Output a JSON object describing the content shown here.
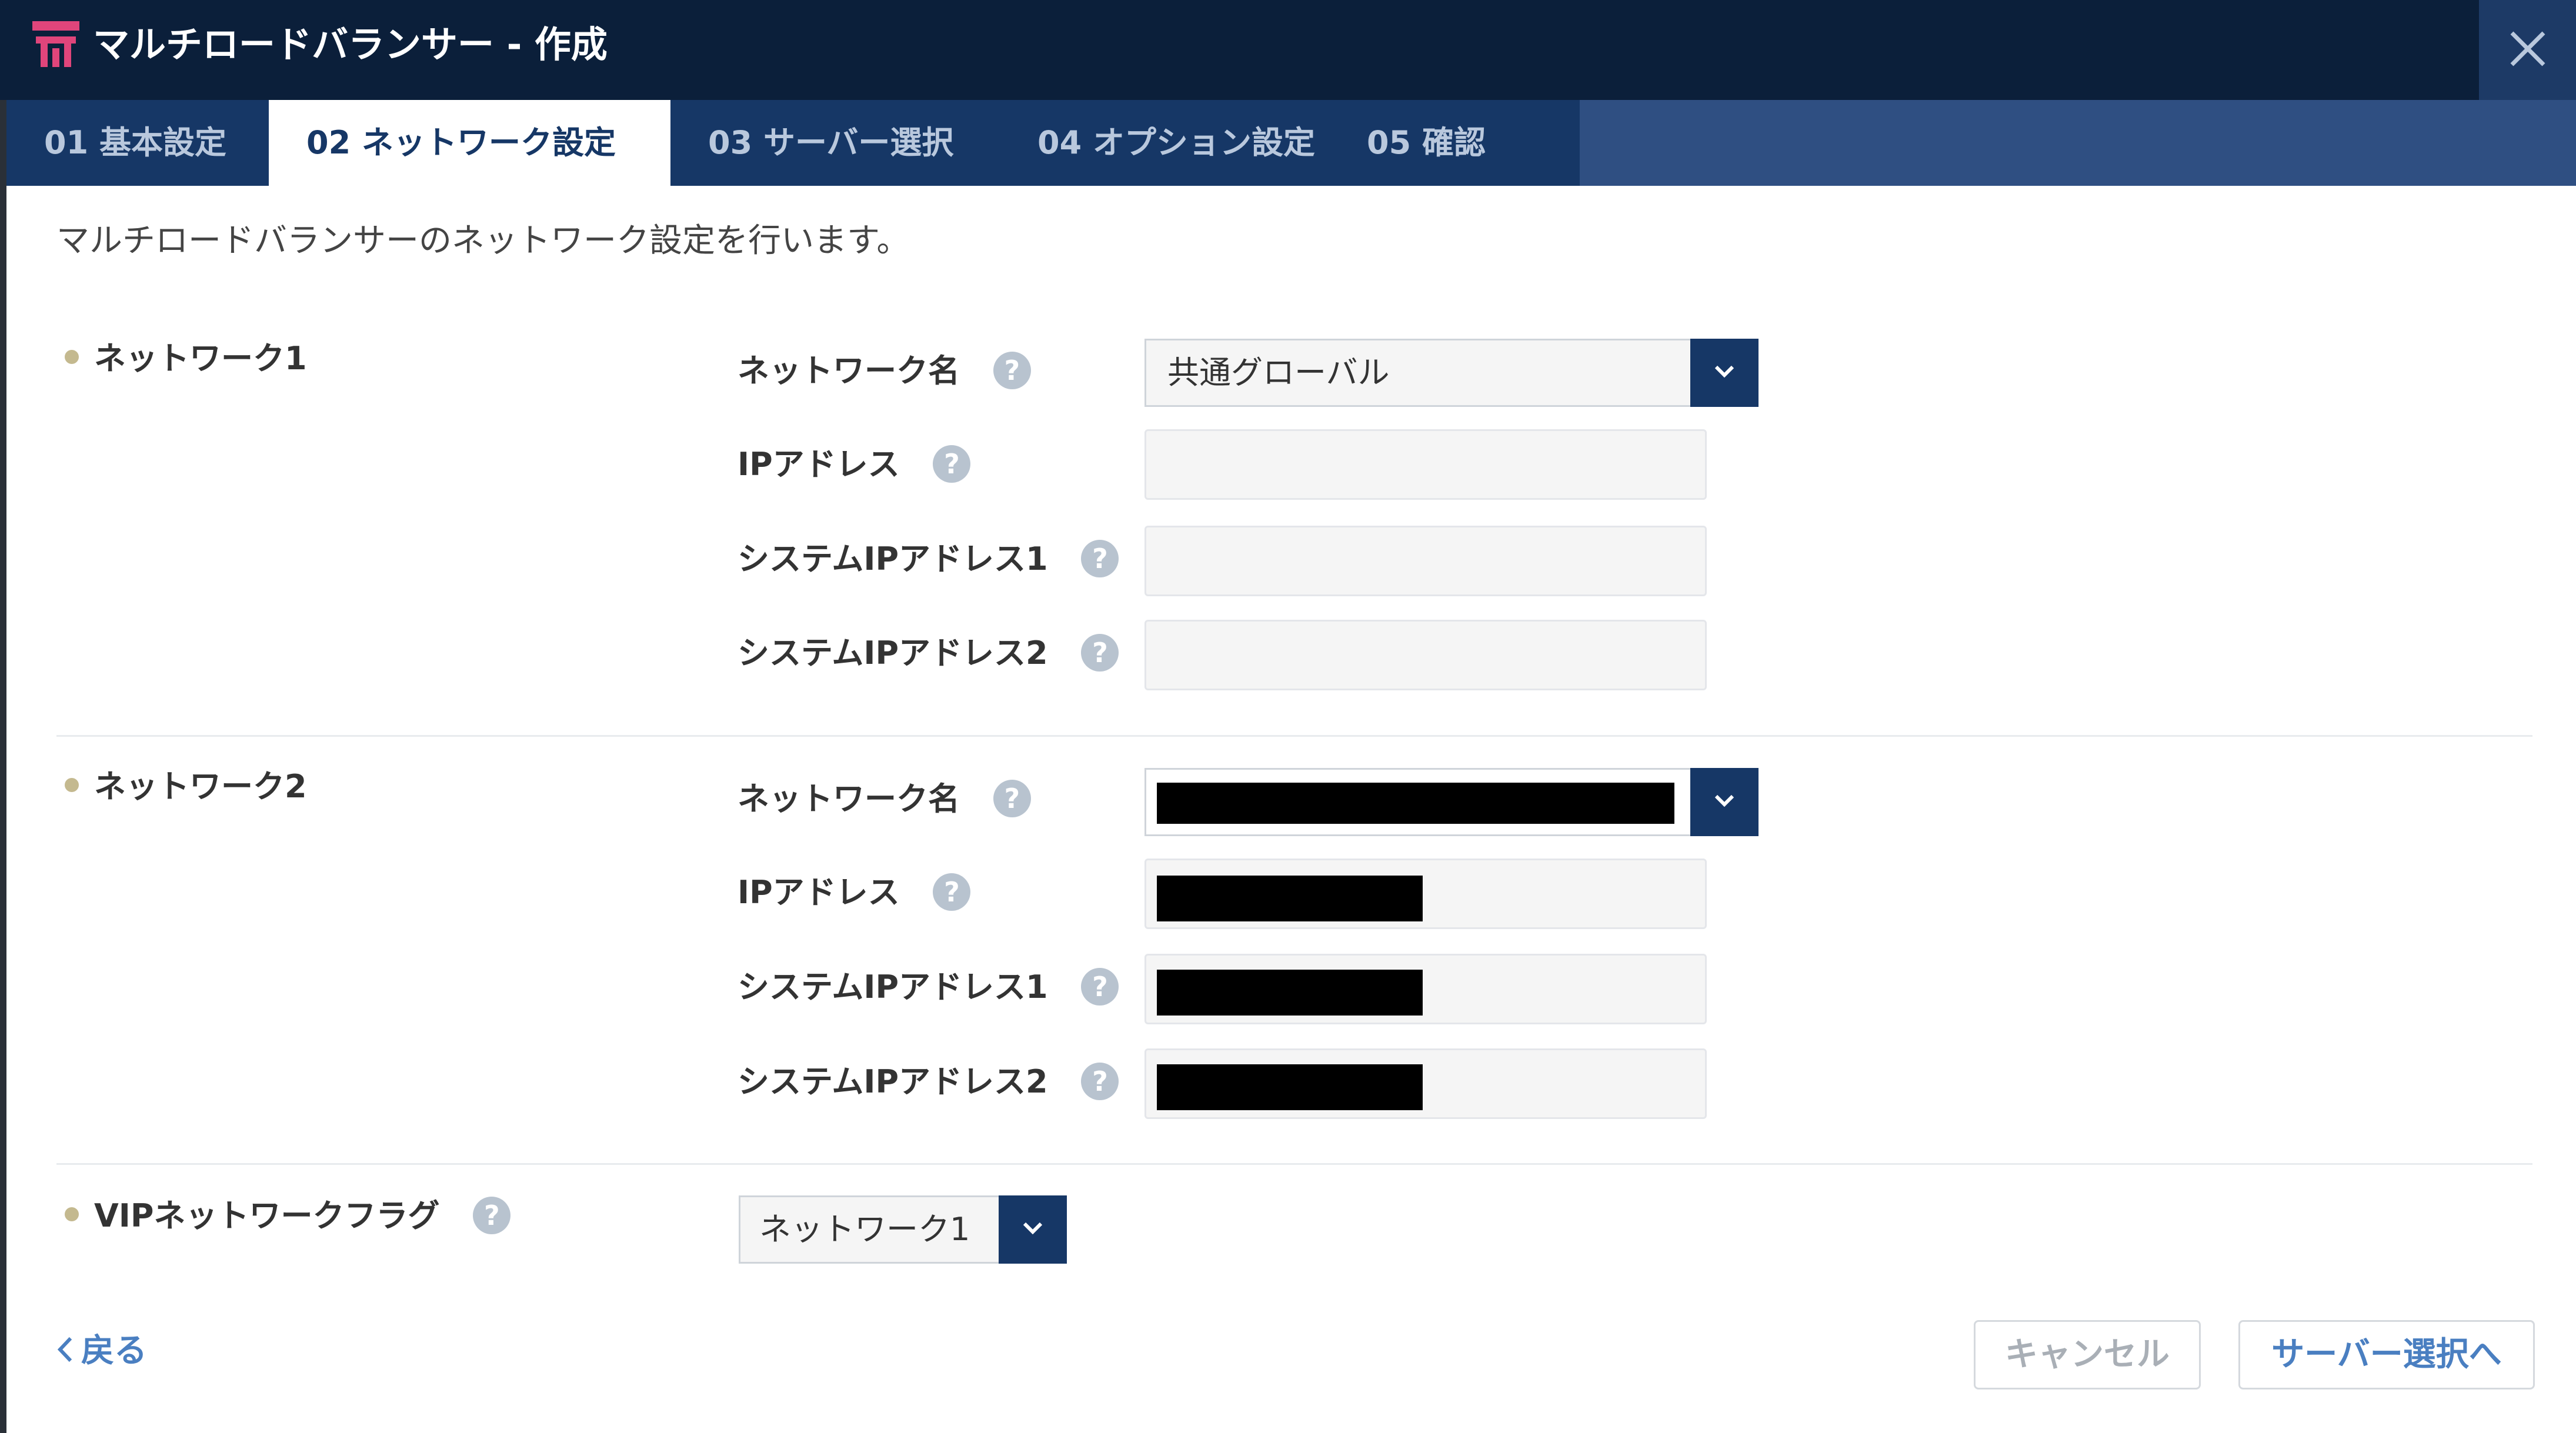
{
  "window": {
    "title": "マルチロードバランサー - 作成"
  },
  "tabs": [
    {
      "label": "01 基本設定",
      "active": false
    },
    {
      "label": "02 ネットワーク設定",
      "active": true
    },
    {
      "label": "03 サーバー選択",
      "active": false
    },
    {
      "label": "04 オプション設定",
      "active": false
    },
    {
      "label": "05 確認",
      "active": false
    }
  ],
  "intro": "マルチロードバランサーのネットワーク設定を行います。",
  "network1": {
    "title": "ネットワーク1",
    "network_name_label": "ネットワーク名",
    "network_name_value": "共通グローバル",
    "ip_label": "IPアドレス",
    "ip_value": "",
    "sys_ip1_label": "システムIPアドレス1",
    "sys_ip1_value": "",
    "sys_ip2_label": "システムIPアドレス2",
    "sys_ip2_value": ""
  },
  "network2": {
    "title": "ネットワーク2",
    "network_name_label": "ネットワーク名",
    "ip_label": "IPアドレス",
    "sys_ip1_label": "システムIPアドレス1",
    "sys_ip2_label": "システムIPアドレス2"
  },
  "vip": {
    "label": "VIPネットワークフラグ",
    "value": "ネットワーク1"
  },
  "footer": {
    "back_label": "戻る",
    "cancel_label": "キャンセル",
    "next_label": "サーバー選択へ"
  },
  "help_glyph": "?",
  "colors": {
    "titlebar": "#0b1f3a",
    "tab_inactive_bg": "#163766",
    "tab_strip_bg": "#2f4f82",
    "accent": "#4a7fc1",
    "bullet": "#c4b98f"
  }
}
